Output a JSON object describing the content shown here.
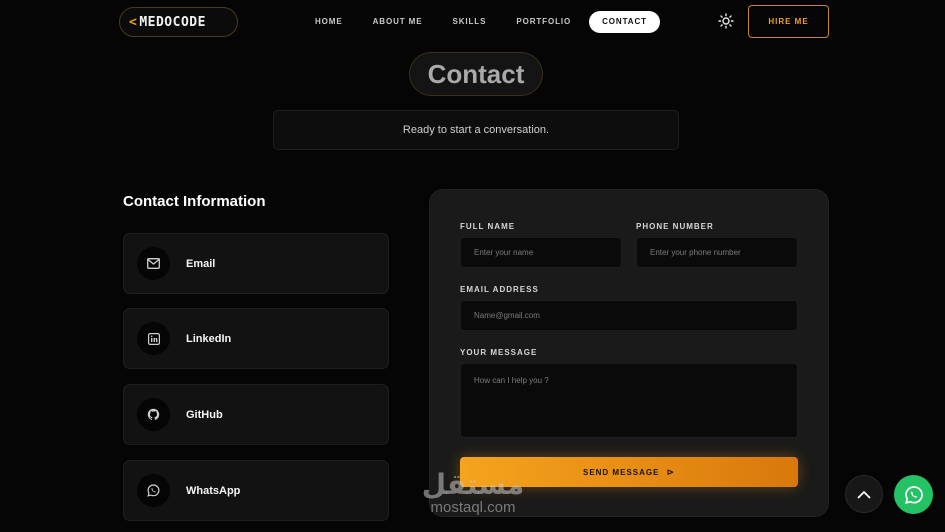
{
  "nav": {
    "logo_prefix": "<",
    "logo_text": "MEDOCODE",
    "links": [
      "HOME",
      "ABOUT ME",
      "SKILLS",
      "PORTFOLIO",
      "CONTACT"
    ],
    "active": "CONTACT",
    "hire_label": "HIRE ME"
  },
  "header": {
    "title": "Contact",
    "subtitle": "Ready to start a conversation."
  },
  "contact_info": {
    "heading": "Contact Information",
    "items": [
      {
        "label": "Email",
        "icon": "mail-icon"
      },
      {
        "label": "LinkedIn",
        "icon": "linkedin-icon"
      },
      {
        "label": "GitHub",
        "icon": "github-icon"
      },
      {
        "label": "WhatsApp",
        "icon": "whatsapp-icon"
      }
    ]
  },
  "form": {
    "full_name_label": "FULL NAME",
    "full_name_placeholder": "Enter your name",
    "phone_label": "PHONE NUMBER",
    "phone_placeholder": "Enter your phone number",
    "email_label": "EMAIL ADDRESS",
    "email_placeholder": "Name@gmail.com",
    "message_label": "YOUR MESSAGE",
    "message_placeholder": "How can I help you ?",
    "submit_label": "SEND MESSAGE"
  },
  "watermark": {
    "arabic": "مستقل",
    "latin": "mostaql.com"
  },
  "colors": {
    "accent": "#f0a020",
    "background": "#050505",
    "panel": "#1a1a1a",
    "whatsapp": "#25c265"
  }
}
